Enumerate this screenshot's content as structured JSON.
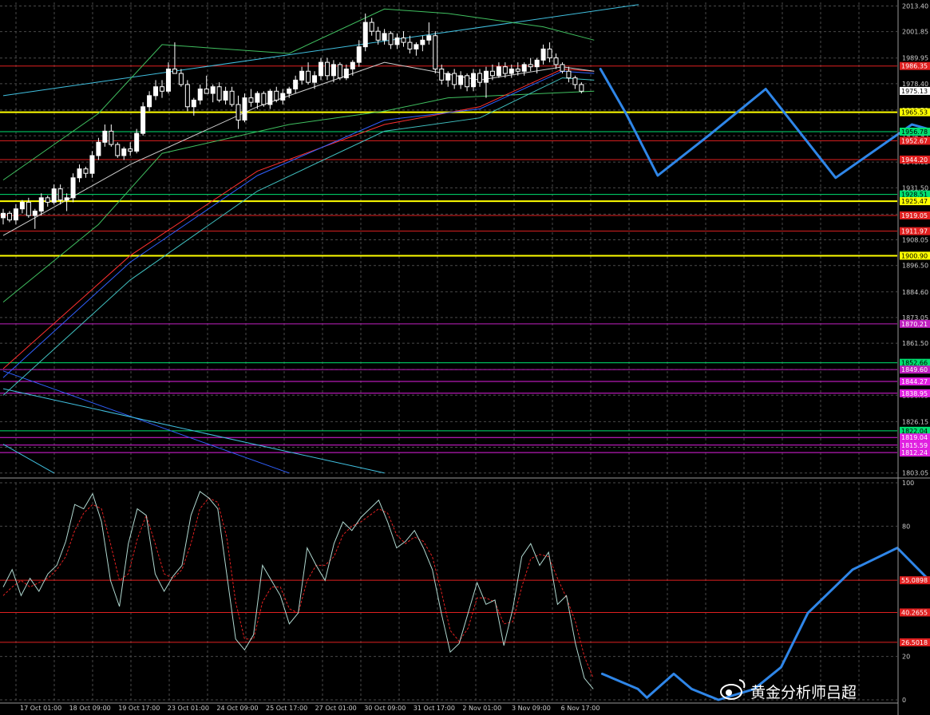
{
  "chart_data": [
    {
      "type": "candlestick",
      "panel": "price",
      "y_ticks": [
        "2013.40",
        "2001.85",
        "1989.95",
        "1978.40",
        "1966.50",
        "1954.95",
        "1943.05",
        "1931.50",
        "1919.60",
        "1908.05",
        "1896.50",
        "1884.60",
        "1873.05",
        "1861.50",
        "1849.60",
        "1838.05",
        "1826.15",
        "1814.60",
        "1803.05"
      ],
      "ylim": [
        1801.5,
        2015.0
      ],
      "x_ticks": [
        "17 Oct 01:00",
        "18 Oct 09:00",
        "19 Oct 17:00",
        "23 Oct 01:00",
        "24 Oct 09:00",
        "25 Oct 17:00",
        "27 Oct 01:00",
        "30 Oct 09:00",
        "31 Oct 17:00",
        "2 Nov 01:00",
        "3 Nov 09:00",
        "6 Nov 17:00"
      ],
      "current_price": {
        "label": "1975.13",
        "value": 1975.13,
        "color": "#ffffff"
      },
      "levels": [
        {
          "label": "1986.35",
          "value": 1986.35,
          "color": "#e02020"
        },
        {
          "label": "1965.53",
          "value": 1965.53,
          "color": "#ffff00"
        },
        {
          "label": "1956.78",
          "value": 1956.78,
          "color": "#00e070"
        },
        {
          "label": "1952.67",
          "value": 1952.67,
          "color": "#e02020"
        },
        {
          "label": "1944.20",
          "value": 1944.2,
          "color": "#e02020"
        },
        {
          "label": "1928.51",
          "value": 1928.51,
          "color": "#00e070"
        },
        {
          "label": "1925.47",
          "value": 1925.47,
          "color": "#ffff00"
        },
        {
          "label": "1919.05",
          "value": 1919.05,
          "color": "#e02020"
        },
        {
          "label": "1911.97",
          "value": 1911.97,
          "color": "#e02020"
        },
        {
          "label": "1900.90",
          "value": 1900.9,
          "color": "#ffff00"
        },
        {
          "label": "1870.21",
          "value": 1870.21,
          "color": "#c020c0"
        },
        {
          "label": "1852.66",
          "value": 1852.66,
          "color": "#00e070"
        },
        {
          "label": "1849.60",
          "value": 1849.6,
          "color": "#c020c0"
        },
        {
          "label": "1844.27",
          "value": 1844.27,
          "color": "#e020e0"
        },
        {
          "label": "1838.95",
          "value": 1838.95,
          "color": "#e020e0"
        },
        {
          "label": "1822.04",
          "value": 1822.04,
          "color": "#00e070"
        },
        {
          "label": "1819.04",
          "value": 1819.04,
          "color": "#e020e0"
        },
        {
          "label": "1815.59",
          "value": 1815.59,
          "color": "#e020e0"
        },
        {
          "label": "1812.24",
          "value": 1812.24,
          "color": "#e020e0"
        }
      ],
      "candles": [
        [
          1918,
          1922,
          1915,
          1920
        ],
        [
          1920,
          1921,
          1916,
          1917
        ],
        [
          1917,
          1924,
          1915,
          1922
        ],
        [
          1922,
          1926,
          1920,
          1925
        ],
        [
          1925,
          1927,
          1918,
          1919
        ],
        [
          1919,
          1922,
          1913,
          1921
        ],
        [
          1921,
          1929,
          1919,
          1927
        ],
        [
          1927,
          1928,
          1923,
          1925
        ],
        [
          1925,
          1933,
          1924,
          1931
        ],
        [
          1931,
          1933,
          1924,
          1926
        ],
        [
          1926,
          1929,
          1921,
          1927
        ],
        [
          1927,
          1938,
          1925,
          1936
        ],
        [
          1936,
          1942,
          1934,
          1940
        ],
        [
          1940,
          1941,
          1936,
          1938
        ],
        [
          1938,
          1948,
          1936,
          1946
        ],
        [
          1946,
          1954,
          1944,
          1952
        ],
        [
          1952,
          1960,
          1950,
          1957
        ],
        [
          1957,
          1960,
          1950,
          1951
        ],
        [
          1951,
          1952,
          1945,
          1946
        ],
        [
          1946,
          1950,
          1944,
          1949
        ],
        [
          1949,
          1952,
          1946,
          1948
        ],
        [
          1948,
          1958,
          1947,
          1956
        ],
        [
          1956,
          1970,
          1955,
          1968
        ],
        [
          1968,
          1975,
          1966,
          1973
        ],
        [
          1973,
          1980,
          1971,
          1977
        ],
        [
          1977,
          1980,
          1972,
          1975
        ],
        [
          1975,
          1988,
          1974,
          1985
        ],
        [
          1985,
          1997,
          1983,
          1983
        ],
        [
          1983,
          1985,
          1977,
          1978
        ],
        [
          1978,
          1980,
          1966,
          1968
        ],
        [
          1968,
          1972,
          1964,
          1971
        ],
        [
          1971,
          1978,
          1969,
          1976
        ],
        [
          1976,
          1982,
          1974,
          1974
        ],
        [
          1974,
          1978,
          1970,
          1977
        ],
        [
          1977,
          1979,
          1970,
          1971
        ],
        [
          1971,
          1977,
          1969,
          1975
        ],
        [
          1975,
          1977,
          1968,
          1969
        ],
        [
          1969,
          1973,
          1958,
          1962
        ],
        [
          1962,
          1974,
          1961,
          1972
        ],
        [
          1972,
          1976,
          1968,
          1970
        ],
        [
          1970,
          1975,
          1967,
          1974
        ],
        [
          1974,
          1975,
          1968,
          1969
        ],
        [
          1969,
          1976,
          1967,
          1975
        ],
        [
          1975,
          1977,
          1970,
          1971
        ],
        [
          1971,
          1976,
          1969,
          1974
        ],
        [
          1974,
          1977,
          1972,
          1976
        ],
        [
          1976,
          1982,
          1974,
          1980
        ],
        [
          1980,
          1986,
          1978,
          1984
        ],
        [
          1984,
          1988,
          1978,
          1979
        ],
        [
          1979,
          1984,
          1976,
          1982
        ],
        [
          1982,
          1990,
          1980,
          1988
        ],
        [
          1988,
          1990,
          1980,
          1982
        ],
        [
          1982,
          1989,
          1979,
          1987
        ],
        [
          1987,
          1988,
          1980,
          1981
        ],
        [
          1981,
          1987,
          1980,
          1985
        ],
        [
          1985,
          1989,
          1982,
          1988
        ],
        [
          1988,
          1998,
          1986,
          1995
        ],
        [
          1995,
          2010,
          1993,
          2006
        ],
        [
          2006,
          2008,
          2000,
          2002
        ],
        [
          2002,
          2004,
          1996,
          1998
        ],
        [
          1998,
          2003,
          1996,
          2001
        ],
        [
          2001,
          2002,
          1994,
          1996
        ],
        [
          1996,
          2001,
          1994,
          1999
        ],
        [
          1999,
          2002,
          1995,
          1997
        ],
        [
          1997,
          2000,
          1992,
          1994
        ],
        [
          1994,
          1997,
          1991,
          1996
        ],
        [
          1996,
          2000,
          1993,
          1998
        ],
        [
          1998,
          2006,
          1996,
          2000
        ],
        [
          2000,
          2002,
          1983,
          1985
        ],
        [
          1985,
          1987,
          1978,
          1980
        ],
        [
          1980,
          1984,
          1977,
          1983
        ],
        [
          1983,
          1985,
          1976,
          1978
        ],
        [
          1978,
          1984,
          1976,
          1982
        ],
        [
          1982,
          1983,
          1975,
          1977
        ],
        [
          1977,
          1985,
          1975,
          1983
        ],
        [
          1983,
          1985,
          1977,
          1979
        ],
        [
          1979,
          1986,
          1972,
          1984
        ],
        [
          1984,
          1987,
          1980,
          1982
        ],
        [
          1982,
          1988,
          1981,
          1986
        ],
        [
          1986,
          1988,
          1981,
          1983
        ],
        [
          1983,
          1987,
          1981,
          1985
        ],
        [
          1985,
          1988,
          1982,
          1984
        ],
        [
          1984,
          1988,
          1982,
          1987
        ],
        [
          1987,
          1990,
          1984,
          1986
        ],
        [
          1986,
          1990,
          1983,
          1989
        ],
        [
          1989,
          1996,
          1987,
          1994
        ],
        [
          1994,
          1997,
          1988,
          1990
        ],
        [
          1990,
          1992,
          1985,
          1987
        ],
        [
          1987,
          1988,
          1983,
          1984
        ],
        [
          1984,
          1986,
          1979,
          1981
        ],
        [
          1981,
          1982,
          1976,
          1978
        ],
        [
          1978,
          1979,
          1974,
          1975
        ]
      ],
      "moving_averages": [
        {
          "color": "#ff3030",
          "points": [
            [
              0,
              1850
            ],
            [
              20,
              1901
            ],
            [
              40,
              1939
            ],
            [
              60,
              1960
            ],
            [
              75,
              1968
            ],
            [
              88,
              1985
            ],
            [
              93,
              1984
            ]
          ]
        },
        {
          "color": "#3060ff",
          "points": [
            [
              0,
              1846
            ],
            [
              20,
              1898
            ],
            [
              40,
              1937
            ],
            [
              60,
              1962
            ],
            [
              75,
              1967
            ],
            [
              88,
              1984
            ],
            [
              93,
              1983
            ]
          ]
        },
        {
          "color": "#40c0c0",
          "points": [
            [
              0,
              1838
            ],
            [
              20,
              1890
            ],
            [
              40,
              1930
            ],
            [
              60,
              1957
            ],
            [
              75,
              1963
            ],
            [
              88,
              1981
            ],
            [
              93,
              1980
            ]
          ]
        },
        {
          "color": "#d0d0d0",
          "points": [
            [
              0,
              1910
            ],
            [
              20,
              1942
            ],
            [
              40,
              1968
            ],
            [
              60,
              1988
            ],
            [
              75,
              1980
            ],
            [
              88,
              1986
            ],
            [
              93,
              1984
            ]
          ]
        }
      ],
      "bollinger_bands": [
        {
          "color": "#40c060",
          "points": [
            [
              0,
              1935
            ],
            [
              15,
              1965
            ],
            [
              25,
              1996
            ],
            [
              45,
              1992
            ],
            [
              60,
              2012
            ],
            [
              70,
              2010
            ],
            [
              85,
              2004
            ],
            [
              93,
              1998
            ]
          ]
        },
        {
          "color": "#40c060",
          "points": [
            [
              0,
              1880
            ],
            [
              15,
              1915
            ],
            [
              25,
              1947
            ],
            [
              45,
              1960
            ],
            [
              60,
              1966
            ],
            [
              70,
              1972
            ],
            [
              85,
              1974
            ],
            [
              93,
              1975
            ]
          ]
        }
      ],
      "trendlines": [
        {
          "color": "#40c0e0",
          "points": [
            [
              0,
              1973
            ],
            [
              100,
              2014
            ]
          ]
        },
        {
          "color": "#3060ff",
          "points": [
            [
              0,
              1849
            ],
            [
              45,
              1803
            ]
          ]
        },
        {
          "color": "#40c0e0",
          "points": [
            [
              0,
              1841
            ],
            [
              60,
              1803
            ]
          ]
        },
        {
          "color": "#40c0e0",
          "points": [
            [
              0,
              1816
            ],
            [
              8,
              1803
            ]
          ]
        }
      ],
      "forecast": {
        "color": "#2f86e8",
        "points": [
          [
            94,
            1985
          ],
          [
            98,
            1965
          ],
          [
            103,
            1937
          ],
          [
            111,
            1955
          ],
          [
            120,
            1976
          ],
          [
            131,
            1936
          ],
          [
            143,
            1960
          ],
          [
            148,
            1956
          ],
          [
            153,
            1943
          ]
        ]
      }
    },
    {
      "type": "line",
      "panel": "stochastic",
      "y_ticks": [
        "100",
        "80",
        "20",
        "0"
      ],
      "ylim": [
        0,
        100
      ],
      "levels": [
        {
          "label": "55.0898",
          "value": 55.0898,
          "color": "#e02020"
        },
        {
          "label": "40.2655",
          "value": 40.2655,
          "color": "#e02020"
        },
        {
          "label": "26.5018",
          "value": 26.5018,
          "color": "#e02020"
        }
      ],
      "main_values": [
        52,
        60,
        48,
        56,
        50,
        58,
        62,
        73,
        90,
        88,
        95,
        82,
        55,
        43,
        72,
        88,
        85,
        58,
        50,
        57,
        62,
        85,
        96,
        93,
        88,
        58,
        28,
        23,
        30,
        62,
        55,
        48,
        35,
        40,
        70,
        62,
        55,
        72,
        82,
        78,
        84,
        88,
        92,
        82,
        70,
        73,
        78,
        70,
        60,
        40,
        22,
        26,
        40,
        54,
        44,
        46,
        25,
        42,
        66,
        72,
        62,
        68,
        44,
        48,
        26,
        10,
        5
      ],
      "signal_values": [
        48,
        52,
        55,
        52,
        54,
        56,
        60,
        66,
        78,
        86,
        90,
        88,
        72,
        55,
        58,
        74,
        85,
        72,
        58,
        56,
        60,
        72,
        88,
        93,
        91,
        75,
        45,
        28,
        28,
        45,
        52,
        52,
        42,
        40,
        55,
        62,
        62,
        66,
        76,
        80,
        82,
        85,
        88,
        86,
        76,
        72,
        75,
        73,
        66,
        50,
        32,
        27,
        33,
        47,
        47,
        45,
        35,
        36,
        52,
        65,
        67,
        66,
        56,
        47,
        36,
        20,
        10
      ],
      "forecast": {
        "color": "#2f86e8",
        "points": [
          [
            67,
            12
          ],
          [
            71,
            5
          ],
          [
            72,
            1
          ],
          [
            75,
            12
          ],
          [
            77,
            5
          ],
          [
            80,
            0
          ],
          [
            84,
            5
          ],
          [
            87,
            15
          ],
          [
            90,
            40
          ],
          [
            95,
            60
          ],
          [
            100,
            70
          ],
          [
            106,
            45
          ],
          [
            108,
            32
          ],
          [
            111,
            58
          ]
        ]
      }
    }
  ],
  "watermark": {
    "text": "黄金分析师吕超",
    "icon": "weibo-icon"
  }
}
